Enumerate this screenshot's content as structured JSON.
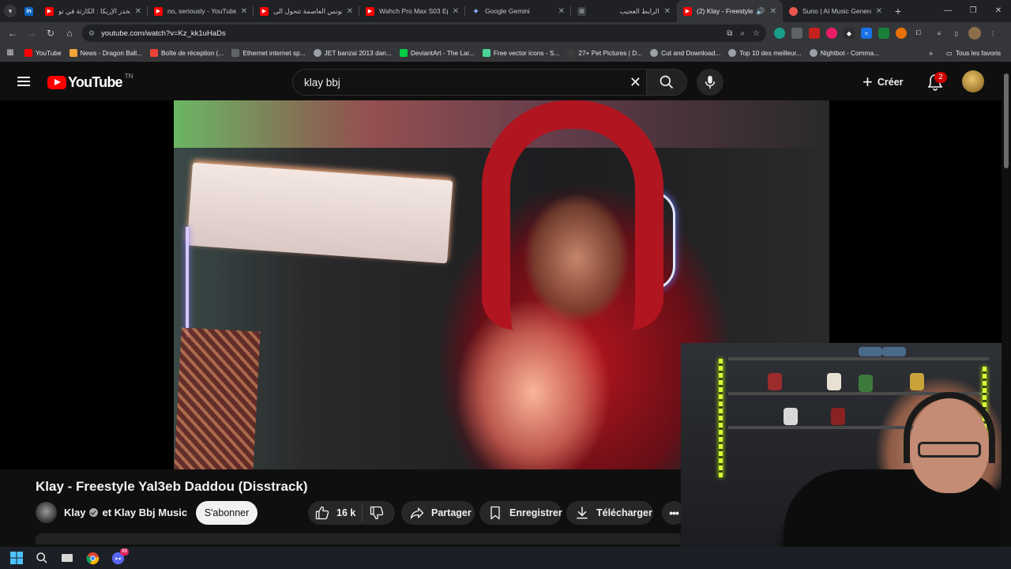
{
  "browser": {
    "tabs": [
      {
        "title": "مخدر الإربكا : الكارثة في تو",
        "favicon": "youtube",
        "active": false
      },
      {
        "title": "no, seriously - YouTube",
        "favicon": "youtube",
        "active": false
      },
      {
        "title": "تونس العاصمة تتحول الى",
        "favicon": "youtube",
        "active": false
      },
      {
        "title": "Wahch Pro Max S03 Epi",
        "favicon": "youtube",
        "active": false
      },
      {
        "title": "Google Gemini",
        "favicon": "gemini",
        "active": false
      },
      {
        "title": "الرابط العجيب",
        "favicon": "generic",
        "active": false
      },
      {
        "title": "(2) Klay - Freestyle Y",
        "favicon": "youtube",
        "active": true
      },
      {
        "title": "Suno | AI Music Generat",
        "favicon": "suno",
        "active": false
      }
    ],
    "url": "youtube.com/watch?v=Kz_kk1uHaDs",
    "bookmarks": [
      {
        "label": "YouTube",
        "color": "#ff0000"
      },
      {
        "label": "News - Dragon Ball...",
        "color": "#f4a53a"
      },
      {
        "label": "Boîte de réception (...",
        "color": "#ea4335"
      },
      {
        "label": "Ethernet internet sp...",
        "color": "#5f6368"
      },
      {
        "label": "JET banzai 2013 dan...",
        "color": "#9aa0a6"
      },
      {
        "label": "DeviantArt - The Lar...",
        "color": "#05cc47"
      },
      {
        "label": "Free vector icons - S...",
        "color": "#4ad295"
      },
      {
        "label": "27+ Pet Pictures | D...",
        "color": "#3c3c3c"
      },
      {
        "label": "Cut and Download...",
        "color": "#9aa0a6"
      },
      {
        "label": "Top 10 des meilleur...",
        "color": "#9aa0a6"
      },
      {
        "label": "Nightbot - Comma...",
        "color": "#9aa0a6"
      }
    ],
    "all_bookmarks_label": "Tous les favoris"
  },
  "youtube": {
    "logo_text": "YouTube",
    "country_code": "TN",
    "search_query": "klay bbj",
    "create_label": "Créer",
    "notification_count": "2",
    "video": {
      "title": "Klay - Freestyle Yal3eb Daddou (Disstrack)",
      "channel": "Klay",
      "collab": "et Klay Bbj Music",
      "subscribe_label": "S'abonner",
      "likes": "16 k",
      "share_label": "Partager",
      "save_label": "Enregistrer",
      "download_label": "Télécharger"
    }
  },
  "colors": {
    "brand_red": "#ff0000",
    "background": "#0f0f0f",
    "pill": "#272727",
    "badge": "#cc0000"
  }
}
